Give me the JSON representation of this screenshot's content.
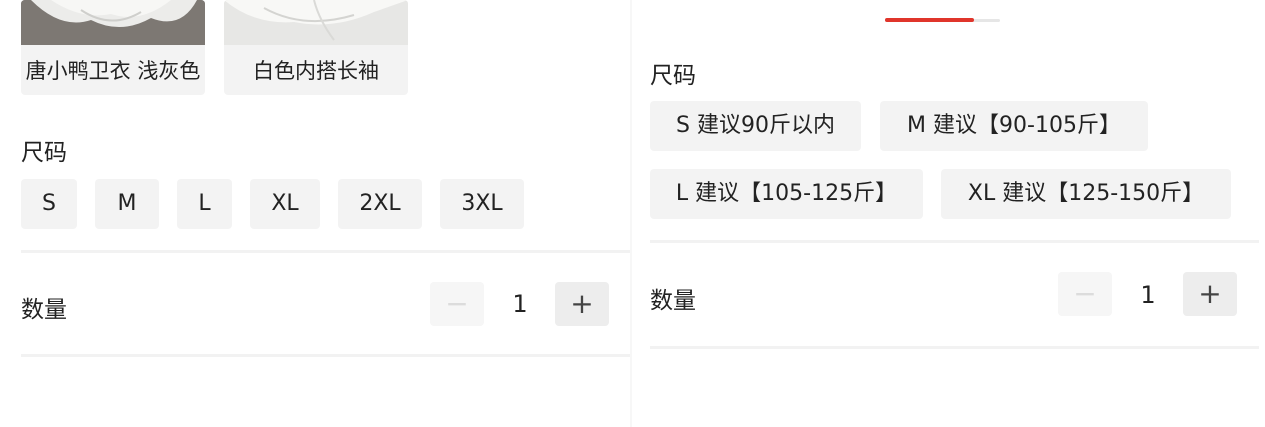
{
  "left": {
    "colors": [
      {
        "label": "唐小鸭卫衣 浅灰色",
        "photo_bg": "#8a8580"
      },
      {
        "label": "白色内搭长袖",
        "photo_bg": "#e9e9e7"
      }
    ],
    "size_title": "尺码",
    "sizes": [
      "S",
      "M",
      "L",
      "XL",
      "2XL",
      "3XL"
    ],
    "quantity_label": "数量",
    "quantity": "1",
    "minus_icon": "minus-icon",
    "plus_icon": "plus-icon"
  },
  "right": {
    "indicator_color": "#e0352b",
    "size_title": "尺码",
    "sizes": [
      "S 建议90斤以内",
      "M 建议【90-105斤】",
      "L 建议【105-125斤】",
      "XL 建议【125-150斤】"
    ],
    "quantity_label": "数量",
    "quantity": "1"
  }
}
